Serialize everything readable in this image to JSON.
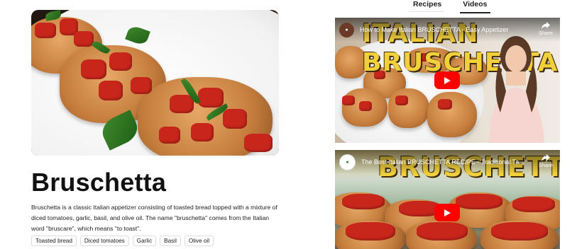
{
  "tabs": [
    "Recipes",
    "Videos"
  ],
  "active_tab": "Videos",
  "recipe": {
    "title": "Bruschetta",
    "description": "Bruschetta is a classic Italian appetizer consisting of toasted bread topped with a mixture of diced tomatoes, garlic, basil, and olive oil. The name \"bruschetta\" comes from the Italian word \"bruscare\", which means \"to toast\".",
    "tags": [
      "Toasted bread",
      "Diced tomatoes",
      "Garlic",
      "Basil",
      "Olive oil"
    ]
  },
  "videos": [
    {
      "title": "How to Make Italian BRUSCHETTA - Easy Appetizer",
      "share_label": "Share",
      "overlay_text": "ITALIAN BRUSCHETTA"
    },
    {
      "title": "The Best Italian BRUSCHETTA RECIPE - Traditional Ta...",
      "share_label": "Share",
      "overlay_text": "BRUSCHETTA"
    }
  ],
  "colors": {
    "play_button": "#ff0000",
    "tab_underline": "#222222",
    "tag_border": "#dcdcdc"
  },
  "icons": [
    "play-icon",
    "share-icon",
    "channel-avatar-icon"
  ]
}
